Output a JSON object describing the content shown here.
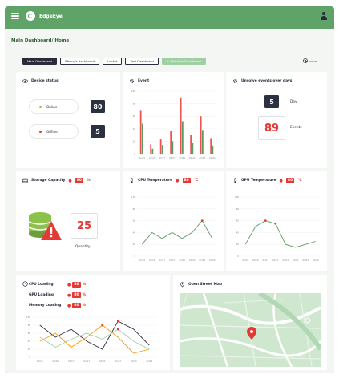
{
  "app": {
    "name": "EdgeEye"
  },
  "breadcrumb": "Main Dashboard/ Home",
  "tabs": [
    {
      "label": "Main Dashboard",
      "active": true
    },
    {
      "label": "Wenny's dashboard",
      "active": false
    },
    {
      "label": "Locket",
      "active": false
    },
    {
      "label": "Test Dashboard",
      "active": false
    },
    {
      "label": "+ Add New Dashboard",
      "active": false
    }
  ],
  "refresh_label": "none",
  "device_status": {
    "title": "Device status",
    "online": {
      "label": "Online",
      "count": "80",
      "color": "#8bc34a"
    },
    "offline": {
      "label": "Offline",
      "count": "5",
      "color": "#e53935"
    }
  },
  "event": {
    "title": "Event",
    "chart_data": {
      "type": "bar",
      "categories": [
        "01/16",
        "01/16",
        "01/17",
        "01/17",
        "01/21",
        "01/22",
        "01/23",
        "01/24"
      ],
      "series": [
        {
          "name": "",
          "color": "#ef5350",
          "values": [
            70,
            15,
            23,
            37,
            90,
            30,
            60,
            25
          ]
        },
        {
          "name": "",
          "color": "#5d9b63",
          "values": [
            48,
            8,
            14,
            20,
            52,
            17,
            38,
            13
          ]
        }
      ],
      "ylim": [
        0,
        100
      ],
      "yticks": [
        "100",
        "80",
        "60",
        "40",
        "20",
        "0"
      ]
    }
  },
  "unsolved": {
    "title": "Unsolve events over days",
    "day_value": "5",
    "day_label": "Day",
    "events_value": "89",
    "events_label": "Events"
  },
  "storage": {
    "title": "Storage Capacity",
    "value": "80",
    "unit": "%",
    "quantity": "25",
    "quantity_label": "Quantity"
  },
  "cpu_temp": {
    "title": "CPU Temperature",
    "value": "80",
    "unit": "°C",
    "chart_data": {
      "type": "line",
      "x": [
        "01/16",
        "01/16",
        "01/17",
        "01/17",
        "01/21",
        "01/22",
        "01/23",
        "01/24"
      ],
      "series": [
        {
          "name": "",
          "color": "#5d9b63",
          "values": [
            20,
            40,
            30,
            40,
            30,
            40,
            60,
            30
          ]
        }
      ],
      "highlight_index": 6,
      "ylim": [
        0,
        100
      ],
      "yticks": [
        "100",
        "80",
        "60",
        "40",
        "20",
        "0"
      ]
    }
  },
  "gpu_temp": {
    "title": "GPU Temperature",
    "value": "80",
    "unit": "°C",
    "chart_data": {
      "type": "line",
      "x": [
        "01/16",
        "01/16",
        "01/17",
        "01/17",
        "01/21",
        "01/22",
        "01/23",
        "01/24"
      ],
      "series": [
        {
          "name": "",
          "color": "#5d9b63",
          "values": [
            20,
            50,
            60,
            55,
            20,
            15,
            20,
            25
          ]
        }
      ],
      "highlight_indices": [
        2,
        3
      ],
      "ylim": [
        0,
        100
      ],
      "yticks": [
        "100",
        "80",
        "60",
        "40",
        "20",
        "0"
      ]
    }
  },
  "loading": {
    "rows": [
      {
        "label": "CPU Loading",
        "value": "80",
        "unit": "%"
      },
      {
        "label": "GPU Loading",
        "value": "80",
        "unit": "%"
      },
      {
        "label": "Memory Loading",
        "value": "80",
        "unit": "%"
      }
    ],
    "chart_data": {
      "type": "line",
      "x": [
        "01/16",
        "01/16",
        "01/17",
        "01/17",
        "01/21",
        "01/22",
        "01/23",
        "01/24"
      ],
      "series": [
        {
          "name": "",
          "color": "#2c3142",
          "values": [
            80,
            50,
            70,
            40,
            20,
            90,
            70,
            30
          ]
        },
        {
          "name": "",
          "color": "#ff9800",
          "values": [
            40,
            60,
            25,
            50,
            80,
            50,
            10,
            20
          ]
        },
        {
          "name": "",
          "color": "#9fd0a4",
          "values": [
            50,
            25,
            45,
            60,
            45,
            70,
            40,
            20
          ]
        }
      ],
      "ylim": [
        0,
        100
      ],
      "yticks": [
        "100",
        "80",
        "60",
        "40",
        "20",
        "0"
      ]
    }
  },
  "map": {
    "title": "Open Street Map"
  }
}
